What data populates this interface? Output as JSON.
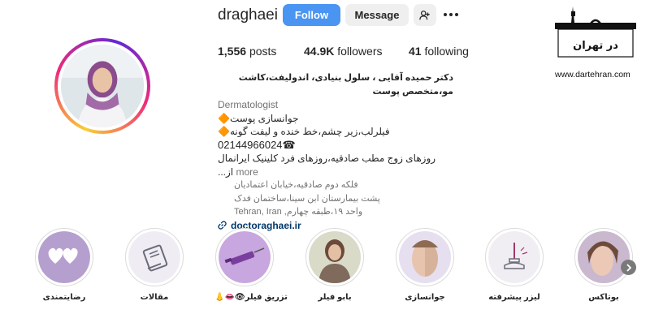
{
  "profile": {
    "username": "draghaei",
    "follow_label": "Follow",
    "message_label": "Message"
  },
  "stats": {
    "posts_count": "1,556",
    "posts_label": "posts",
    "followers_count": "44.9K",
    "followers_label": "followers",
    "following_count": "41",
    "following_label": "following"
  },
  "bio": {
    "name": "دکتر حمیده آقایی ، سلول بنیادی، اندولیفت،کاشت مو،متخصص پوست",
    "category": "Dermatologist",
    "line1": "جوانسازی پوست🔶",
    "line2": "فیلرلب،زیر چشم،خط خنده و لیفت گونه🔶",
    "phone": "02144966024☎",
    "line3": "روزهای زوج مطب صادقیه،روزهای فرد کلینیک ایرانمال از...",
    "more_label": "more",
    "address1": "فلکه دوم صادقیه،خیابان اعتمادیان",
    "address2": "پشت بیمارستان ابن سینا،ساختمان فدک",
    "address3": "واحد ۱۹،طبقه چهارم, Tehran, Iran",
    "website": "doctoraghaei.ir"
  },
  "logo": {
    "text": "در تهران",
    "url": "www.dartehran.com"
  },
  "highlights": [
    {
      "label": "رضایتمندی",
      "icon": "hearts-icon"
    },
    {
      "label": "مقالات",
      "icon": "articles-icon"
    },
    {
      "label": "👃👄👁تزریق فیلر",
      "icon": "syringe-icon"
    },
    {
      "label": "بابو فیلر",
      "icon": "doctor-photo"
    },
    {
      "label": "جوانسازی",
      "icon": "face-icon"
    },
    {
      "label": "لیزر پیشرفته",
      "icon": "laser-icon"
    },
    {
      "label": "بوتاکس",
      "icon": "botox-face"
    }
  ],
  "colors": {
    "follow_button": "#4a94f2",
    "link": "#00376b",
    "muted": "#737373"
  }
}
